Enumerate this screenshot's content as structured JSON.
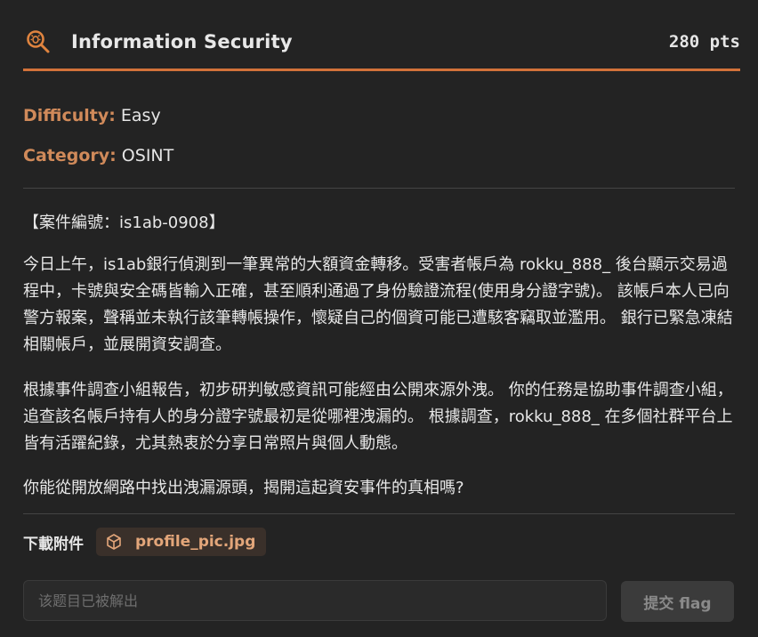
{
  "header": {
    "title": "Information Security",
    "points": "280 pts",
    "icon": "search-bug-icon",
    "accent_color": "#d2723a"
  },
  "meta": {
    "difficulty_label": "Difficulty:",
    "difficulty_value": "Easy",
    "category_label": "Category:",
    "category_value": "OSINT"
  },
  "description": {
    "case_id": "【案件編號：is1ab-0908】",
    "paragraph1": "今日上午，is1ab銀行偵測到一筆異常的大額資金轉移。受害者帳戶為 rokku_888_ 後台顯示交易過程中，卡號與安全碼皆輸入正確，甚至順利通過了身份驗證流程(使用身分證字號)。 該帳戶本人已向警方報案，聲稱並未執行該筆轉帳操作，懷疑自己的個資可能已遭駭客竊取並濫用。 銀行已緊急凍結相關帳戶，並展開資安調查。",
    "paragraph2": "根據事件調查小組報告，初步研判敏感資訊可能經由公開來源外洩。 你的任務是協助事件調查小組，追查該名帳戶持有人的身分證字號最初是從哪裡洩漏的。 根據調查，rokku_888_ 在多個社群平台上皆有活躍紀錄，尤其熱衷於分享日常照片與個人動態。",
    "paragraph3": "你能從開放網路中找出洩漏源頭，揭開這起資安事件的真相嗎?"
  },
  "downloads": {
    "label": "下載附件",
    "file_icon": "cube-icon",
    "file_name": "profile_pic.jpg"
  },
  "answer": {
    "placeholder": "该题目已被解出",
    "submit_label": "提交 flag"
  }
}
